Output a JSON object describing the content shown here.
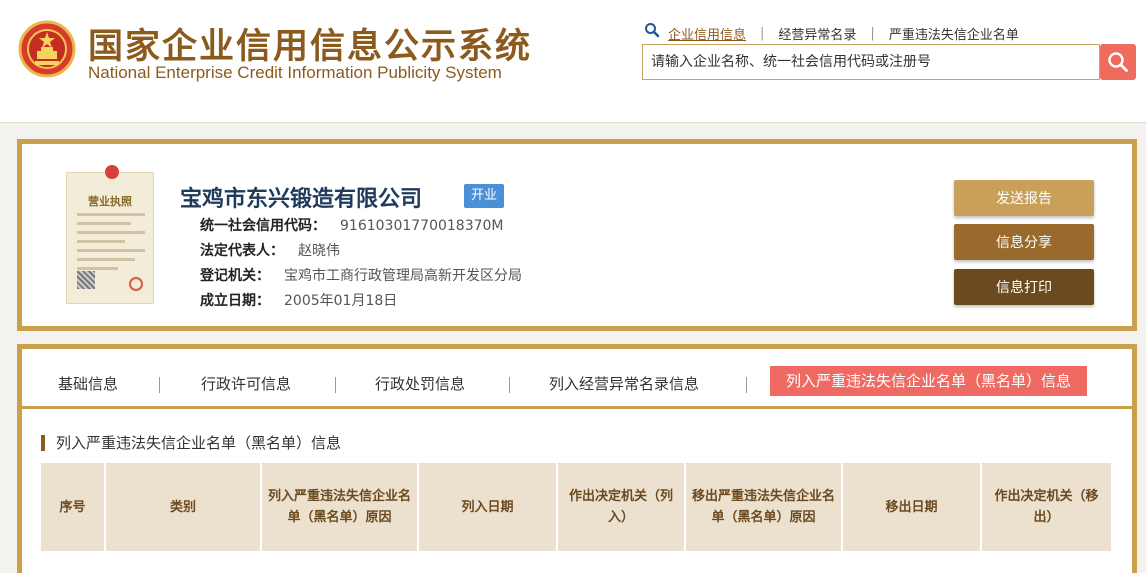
{
  "header": {
    "title_cn": "国家企业信用信息公示系统",
    "title_en": "National Enterprise Credit Information Publicity System",
    "nav_links": [
      "企业信用信息",
      "经营异常名录",
      "严重违法失信企业名单"
    ],
    "search_placeholder": "请输入企业名称、统一社会信用代码或注册号"
  },
  "company": {
    "name": "宝鸡市东兴锻造有限公司",
    "status": "开业",
    "license_title": "营业执照",
    "fields": [
      {
        "label": "统一社会信用代码：",
        "value": "91610301770018370M"
      },
      {
        "label": "法定代表人：",
        "value": "赵晓伟"
      },
      {
        "label": "登记机关：",
        "value": "宝鸡市工商行政管理局高新开发区分局"
      },
      {
        "label": "成立日期：",
        "value": "2005年01月18日"
      }
    ]
  },
  "actions": {
    "send_report": "发送报告",
    "share": "信息分享",
    "print": "信息打印"
  },
  "tabs": [
    "基础信息",
    "行政许可信息",
    "行政处罚信息",
    "列入经营异常名录信息",
    "列入严重违法失信企业名单（黑名单）信息"
  ],
  "section": {
    "title": "列入严重违法失信企业名单（黑名单）信息",
    "columns": [
      "序号",
      "类别",
      "列入严重违法失信企业名单（黑名单）原因",
      "列入日期",
      "作出决定机关（列入）",
      "移出严重违法失信企业名单（黑名单）原因",
      "移出日期",
      "作出决定机关（移出）"
    ]
  },
  "colors": {
    "brand_brown": "#8b5a1d",
    "frame_gold": "#c9a14d",
    "active_tab": "#f06a64",
    "status_blue": "#4a8fd8",
    "search_button": "#ee6b5e"
  }
}
